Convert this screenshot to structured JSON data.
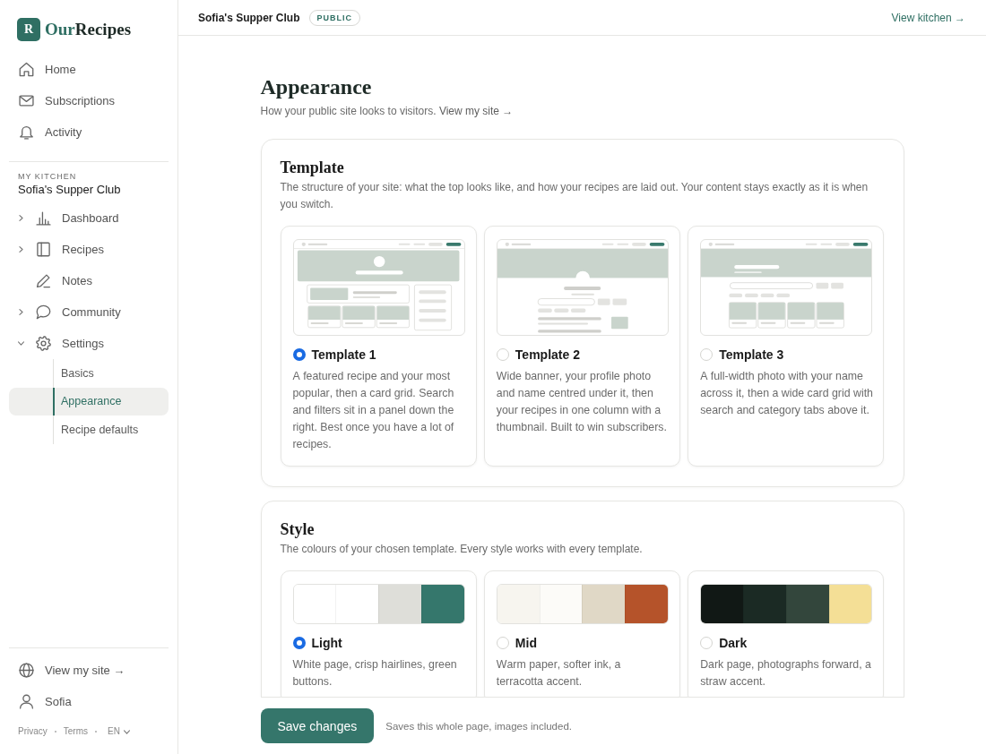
{
  "sidebar": {
    "brand": {
      "mark": "R",
      "name_lead": "Our",
      "name_rest": "Recipes"
    },
    "nav": [
      {
        "label": "Home",
        "selected": false
      },
      {
        "label": "Subscriptions",
        "selected": false
      },
      {
        "label": "Activity",
        "selected": false
      }
    ],
    "kitchen": {
      "heading": "MY KITCHEN",
      "name": "Sofia's Supper Club"
    },
    "tree": [
      {
        "label": "Dashboard",
        "selected": false,
        "expanded": false
      },
      {
        "label": "Recipes",
        "selected": false,
        "expanded": false
      },
      {
        "label": "Notes",
        "selected": false
      },
      {
        "label": "Community",
        "selected": false,
        "expanded": false
      },
      {
        "label": "Settings",
        "selected": false,
        "expanded": true,
        "children": [
          {
            "label": "Basics",
            "selected": false
          },
          {
            "label": "Appearance",
            "selected": true
          },
          {
            "label": "Recipe defaults",
            "selected": false
          }
        ]
      }
    ],
    "bottom": [
      {
        "label": "View my site →",
        "selected": false
      },
      {
        "label": "Sofia",
        "selected": false
      }
    ],
    "footer": {
      "links": [
        "Privacy",
        "Terms"
      ],
      "language": "EN"
    }
  },
  "header": {
    "title": "Sofia's Supper Club",
    "badge": "PUBLIC",
    "link": "View kitchen →"
  },
  "page": {
    "title": "Appearance",
    "subtitle": "How your public site looks to visitors.",
    "subtitle_link": "View my site →"
  },
  "template": {
    "title": "Template",
    "description": "The structure of your site: what the top looks like, and how your recipes are laid out. Your content stays exactly as it is when you switch.",
    "options": [
      {
        "kind": "featured",
        "name": "Template 1",
        "selected": true,
        "description": "A featured recipe and your most popular, then a card grid. Search and filters sit in a panel down the right. Best once you have a lot of recipes."
      },
      {
        "kind": "banner",
        "name": "Template 2",
        "selected": false,
        "description": "Wide banner, your profile photo and name centred under it, then your recipes in one column with a thumbnail. Built to win subscribers."
      },
      {
        "kind": "fullbleed",
        "name": "Template 3",
        "selected": false,
        "description": "A full-width photo with your name across it, then a wide card grid with search and category tabs above it."
      }
    ]
  },
  "style": {
    "title": "Style",
    "description": "The colours of your chosen template. Every style works with every template.",
    "options": [
      {
        "name": "Light",
        "selected": true,
        "swatches": [
          {
            "color": "#ffffff"
          },
          {
            "color": "#ffffff"
          },
          {
            "color": "#deded9"
          },
          {
            "color": "#35776c"
          }
        ],
        "description": "White page, crisp hairlines, green buttons."
      },
      {
        "name": "Mid",
        "selected": false,
        "swatches": [
          {
            "color": "#f7f5ef"
          },
          {
            "color": "#fcfbf8"
          },
          {
            "color": "#e0d8c6"
          },
          {
            "color": "#b5532a"
          }
        ],
        "description": "Warm paper, softer ink, a terracotta accent."
      },
      {
        "name": "Dark",
        "selected": false,
        "swatches": [
          {
            "color": "#111815"
          },
          {
            "color": "#1b2a24"
          },
          {
            "color": "#33463c"
          },
          {
            "color": "#f4df96"
          }
        ],
        "description": "Dark page, photographs forward, a straw accent."
      }
    ]
  },
  "save_bar": {
    "button": "Save changes",
    "note": "Saves this whole page, images included."
  }
}
